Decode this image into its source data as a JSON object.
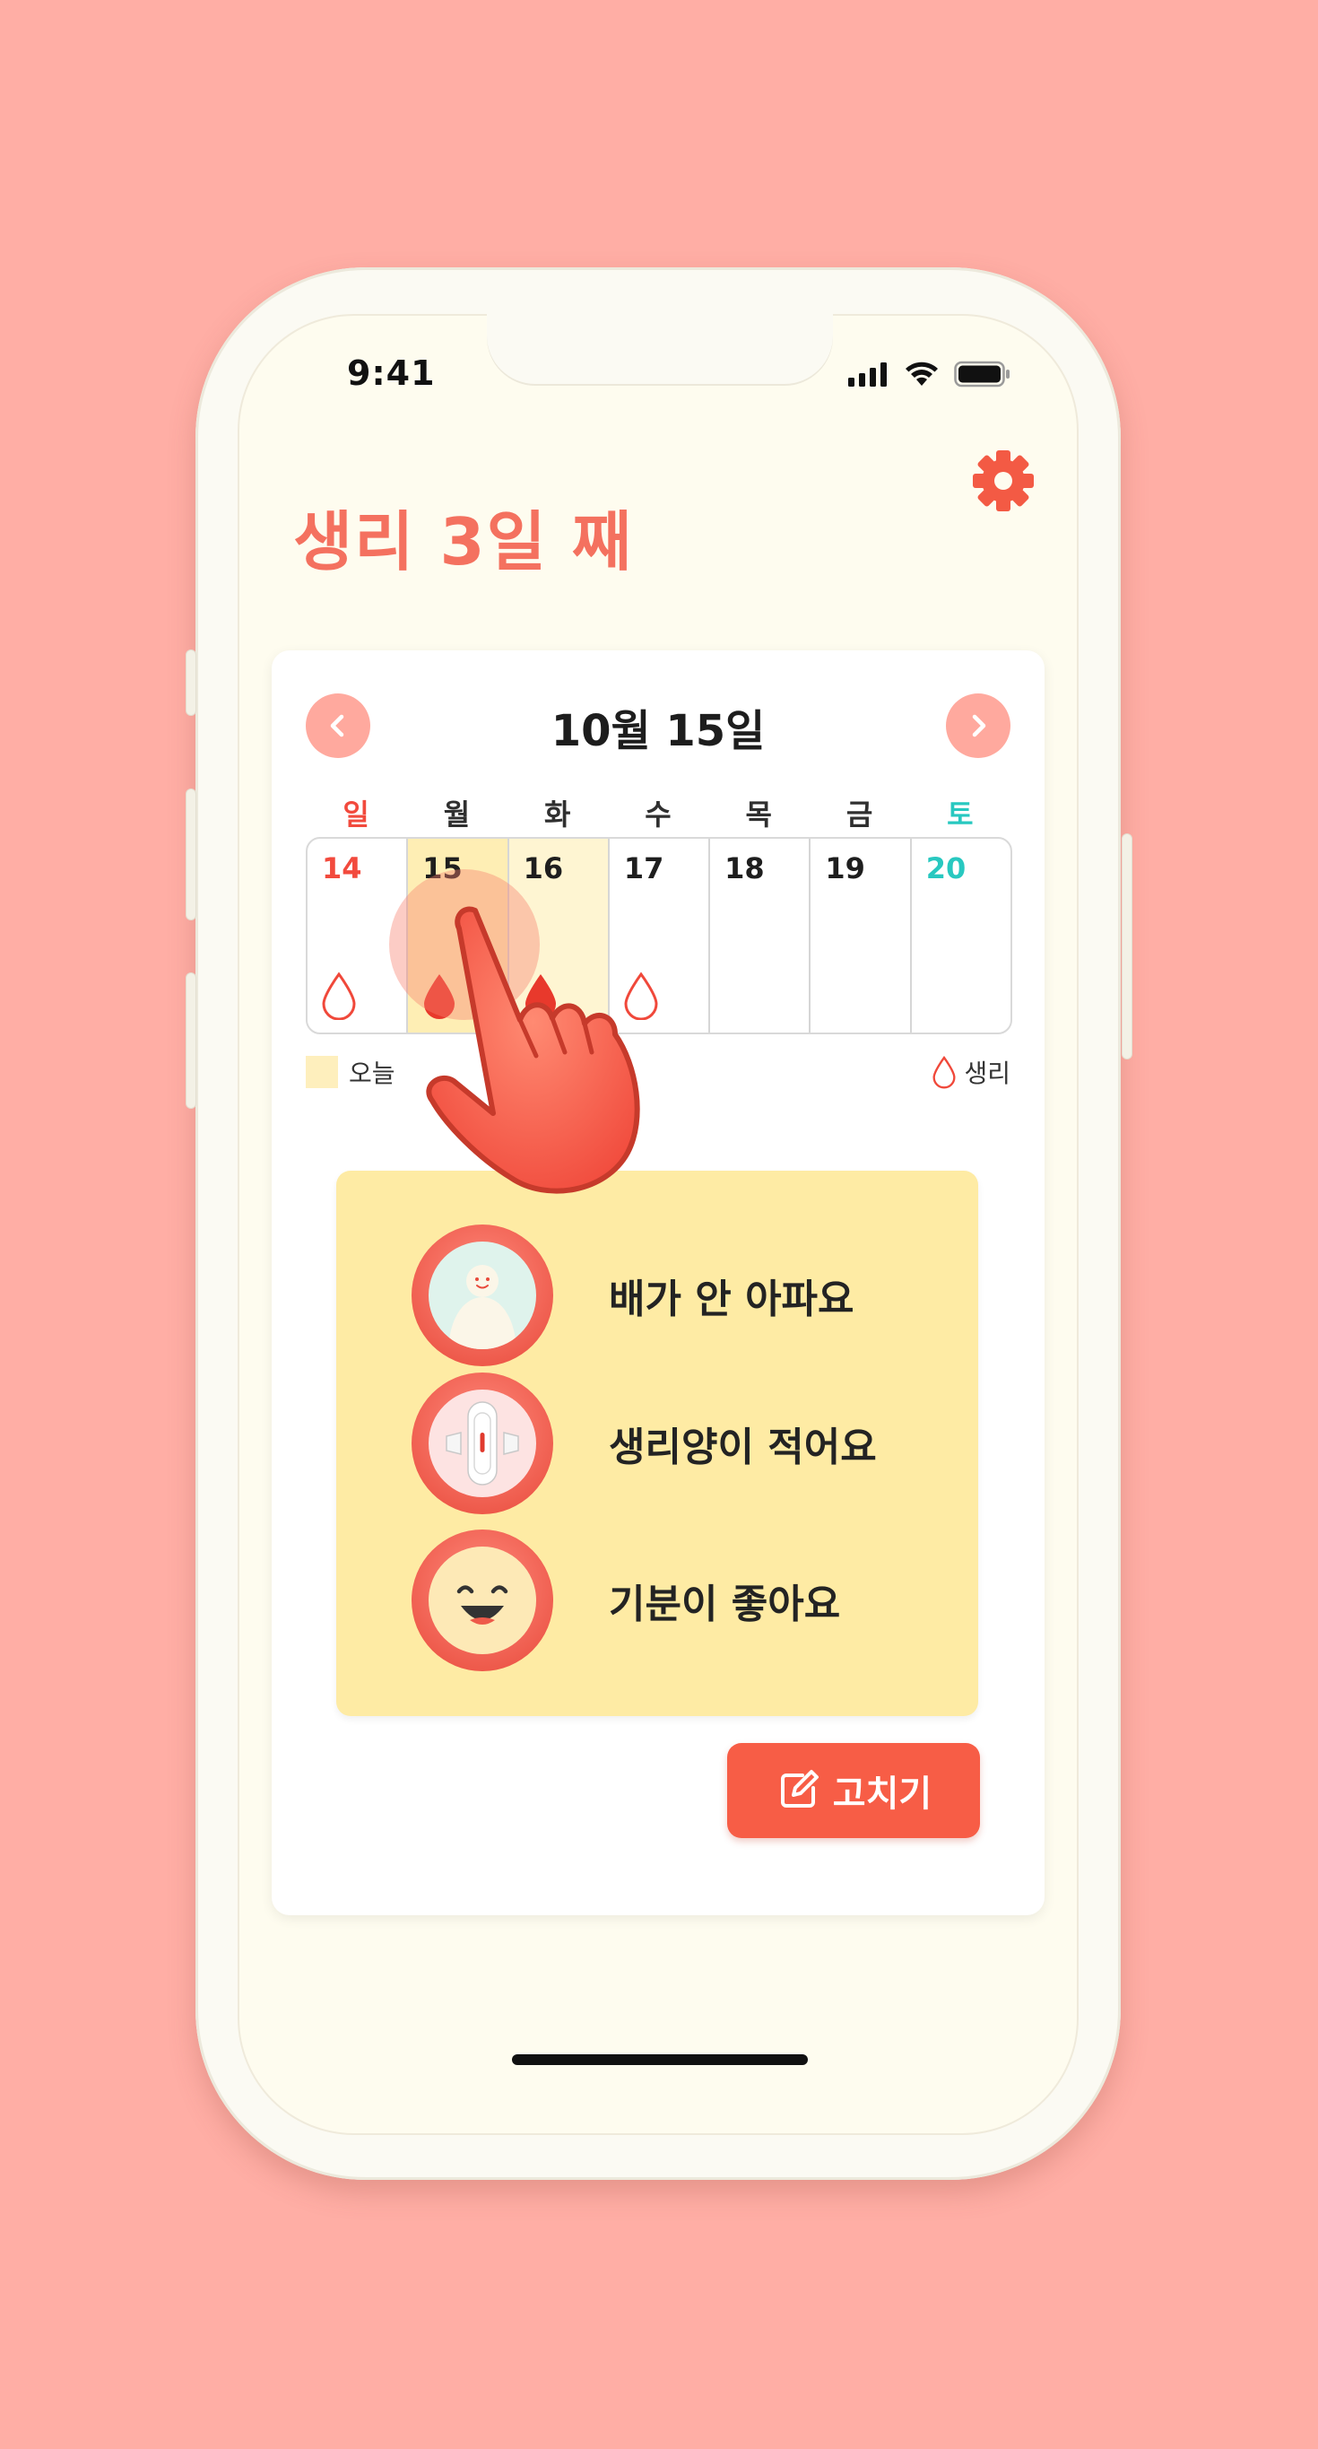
{
  "status_bar": {
    "time": "9:41"
  },
  "header": {
    "title": "생리 3일 째",
    "settings_icon": "gear-icon"
  },
  "calendar": {
    "date_heading": "10월 15일",
    "prev_icon": "chevron-left-icon",
    "next_icon": "chevron-right-icon",
    "weekdays": [
      "일",
      "월",
      "화",
      "수",
      "목",
      "금",
      "토"
    ],
    "days": [
      "14",
      "15",
      "16",
      "17",
      "18",
      "19",
      "20"
    ],
    "today_index": 1,
    "period_days": [
      "14",
      "15",
      "16",
      "17"
    ],
    "legend": {
      "today": "오늘",
      "period": "생리"
    }
  },
  "colors": {
    "accent": "#f4715f",
    "background": "#ffaea5",
    "today": "#feeeb4",
    "mood_panel": "#feeba4",
    "button": "#f75d46"
  },
  "moods": [
    {
      "label": "배가 안 아파요",
      "icon": "person-icon"
    },
    {
      "label": "생리양이 적어요",
      "icon": "pad-icon"
    },
    {
      "label": "기분이 좋아요",
      "icon": "smiley-icon"
    }
  ],
  "actions": {
    "edit_label": "고치기",
    "edit_icon": "edit-icon"
  }
}
